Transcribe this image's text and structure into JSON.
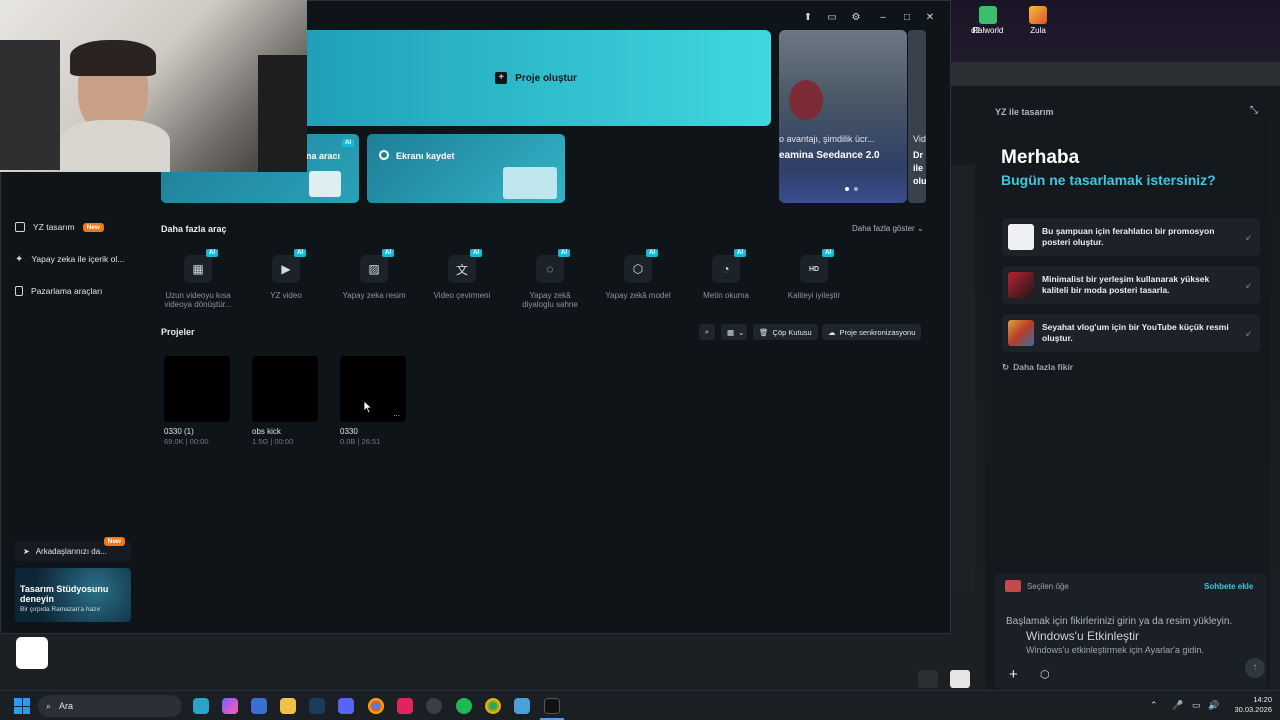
{
  "desktop": {
    "icons": [
      {
        "label": "d2"
      },
      {
        "label": "Palworld"
      },
      {
        "label": "Zula"
      }
    ]
  },
  "app": {
    "hero": {
      "create_project": "Proje oluştur"
    },
    "cards": {
      "card1_label": "na aracı",
      "card2_label": "Ekranı kaydet",
      "promo_text1": "o avantajı, şimdilik ücr...",
      "promo_text2": "eamina Seedance 2.0",
      "promo_text3": "Vid",
      "promo_text4": "Dr",
      "promo_text5": "ile",
      "promo_text6": "olu",
      "ai": "AI"
    },
    "sidebar": {
      "items": [
        {
          "label": "YZ tasarım",
          "badge": "New"
        },
        {
          "label": "Yapay zeka ile içerik ol..."
        },
        {
          "label": "Pazarlama araçları"
        }
      ],
      "invite": {
        "label": "Arkadaşlarınızı da...",
        "badge": "New"
      },
      "studio": {
        "title": "Tasarım Stüdyosunu deneyin",
        "subtitle": "Bir çırpıda Ramazan'a hazır"
      }
    },
    "tools_section": {
      "title": "Daha fazla araç",
      "show_more": "Daha fazla göster",
      "tools": [
        {
          "label": "Uzun videoyu kısa videoya dönüştür...",
          "icon": "film-icon"
        },
        {
          "label": "YZ video",
          "icon": "video-plus-icon"
        },
        {
          "label": "Yapay zeka resim",
          "icon": "image-icon"
        },
        {
          "label": "Video çevirmeni",
          "icon": "translate-icon"
        },
        {
          "label": "Yapay zekâ diyaloglu sahne",
          "icon": "dialog-icon"
        },
        {
          "label": "Yapay zekâ model",
          "icon": "shirt-icon"
        },
        {
          "label": "Metin okuma",
          "icon": "speech-icon"
        },
        {
          "label": "Kaliteyi iyileştir",
          "icon": "hd-icon"
        }
      ]
    },
    "projects_section": {
      "title": "Projeler",
      "trash": "Çöp Kutusu",
      "sync": "Proje senkronizasyonu",
      "projects": [
        {
          "name": "0330 (1)",
          "meta": "69.0K | 00:00"
        },
        {
          "name": "obs kick",
          "meta": "1.5G | 00:00"
        },
        {
          "name": "0330",
          "meta": "0.0B | 26:51"
        }
      ],
      "more": "..."
    }
  },
  "ai_panel": {
    "title": "YZ ile tasarım",
    "greeting": "Merhaba",
    "question": "Bugün ne tasarlamak istersiniz?",
    "suggestions": [
      {
        "text": "Bu şampuan için ferahlatıcı bir promosyon posteri oluştur."
      },
      {
        "text": "Minimalist bir yerleşim kullanarak yüksek kaliteli bir moda posteri tasarla."
      },
      {
        "text": "Seyahat vlog'um için bir YouTube küçük resmi oluştur."
      }
    ],
    "more_ideas": "Daha fazla fikir",
    "selected_item": "Seçilen öğe",
    "add_to_chat": "Sohbete ekle",
    "input_placeholder": "Başlamak için fikirlerinizi girin ya da resim yükleyin.",
    "watermark_title": "Windows'u Etkinleştir",
    "watermark_sub": "Windows'u etkinleştirmek için Ayarlar'a gidin."
  },
  "taskbar": {
    "search": "Ara",
    "time": "14:20",
    "date": "30.03.2026"
  },
  "colors": {
    "accent": "#19b8d6",
    "new_badge": "#f07a1a",
    "teal_gradient_start": "#1f9fb8",
    "teal_gradient_end": "#3fd8de"
  }
}
